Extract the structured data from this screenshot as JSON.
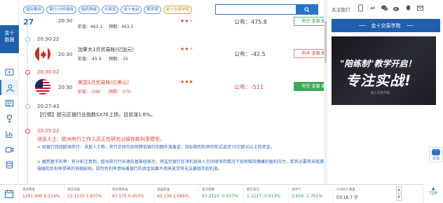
{
  "sidebar": {
    "brand_line1": "金十",
    "brand_line2": "数据"
  },
  "header": {
    "live_badge": "27",
    "tags": [
      "国际要闻",
      "银行/分析报告",
      "投机情绪",
      "交易员",
      "金十电台",
      "期货版",
      "金十交易学院"
    ],
    "search": {
      "placeholder": "",
      "value": ""
    }
  },
  "events": [
    {
      "time": "20:30",
      "title": "",
      "prev": "前值：463.1",
      "forecast": "预期：463.1",
      "stars": 2,
      "actual": "公布：475.8",
      "impact": "利空 金银 原油",
      "style": "outline-green"
    },
    {
      "stamp": "20:30:22",
      "time": "20:30",
      "title": "加拿大1月贸易帐(亿加元)",
      "prev": "前值：-45.9",
      "forecast": "预期：-35",
      "stars": 2,
      "actual": "公布：-42.5",
      "impact": "利多 金银 原油",
      "style": "outline-red"
    },
    {
      "stamp": "20:30:02",
      "time": "20:30",
      "title": "美国1月贸易帐(亿美元)",
      "prev": "前值：-598",
      "forecast": "预期：-570",
      "stars": 3,
      "actual": "公布：-511",
      "impact": "利空 金银 原油",
      "style": "solid-green"
    }
  ],
  "news": [
    {
      "time": "20:27:43",
      "text": "【行情】欧元区银行业指数SX7E上扬，目前涨1.6%。"
    },
    {
      "time": "20:25:22",
      "headline": "消息人士：欧洲央行工作人员正在研究分级存款利率模型。",
      "body1": "> 经银行持团欧洲央行：消息人士称，央行正研究如何降低银行的额外准备金，目标限到利率的形式返还70亿欧元以上的资金。",
      "body2": "> 据悉基于利率：有分析注意到，欧洲央行行长德拉基曾经表示，将监控银行在净利息收入空间收窄的情况下如何维持健康的盈利压力，若有必要将采取措施缓和负利率带来的消极影响，因为负利率意味着银行的资金如果不用来放贷将无法赢取存款利息。"
    }
  ],
  "right_panel": {
    "follow_label": "关注我们",
    "academy_title": "金十交易学院",
    "banner_line1": "\"陪练制\"教学开启！",
    "banner_line2": "专注实战!",
    "banner_logo": "金十交易学院",
    "float_label": "反馈"
  },
  "ticker": [
    {
      "name": "现货黄金",
      "value": "1291.990  0.214%",
      "color": "red"
    },
    {
      "name": "现货白银",
      "value": "15.1120  1.607%",
      "color": "red"
    },
    {
      "name": "布伦特原油",
      "value": "67.575  0.453%",
      "color": "red"
    },
    {
      "name": "美国原油",
      "value": "60.136  1.066%",
      "color": "red"
    },
    {
      "name": "美元指数",
      "value": "97.2110  -0.037%",
      "color": "green"
    },
    {
      "name": "欧元美元",
      "value": "1.1217  -0.013%",
      "color": "green"
    },
    {
      "name": "天然气",
      "value": "2.659  -1.701%",
      "color": "green"
    },
    {
      "name": "COMEX 黄金",
      "value": "03:16  7 字",
      "color": "dark"
    }
  ],
  "top_button": "TOP",
  "colors": {
    "brand": "#1f5fae",
    "up": "#e04a2c",
    "down": "#2e9a4c"
  }
}
